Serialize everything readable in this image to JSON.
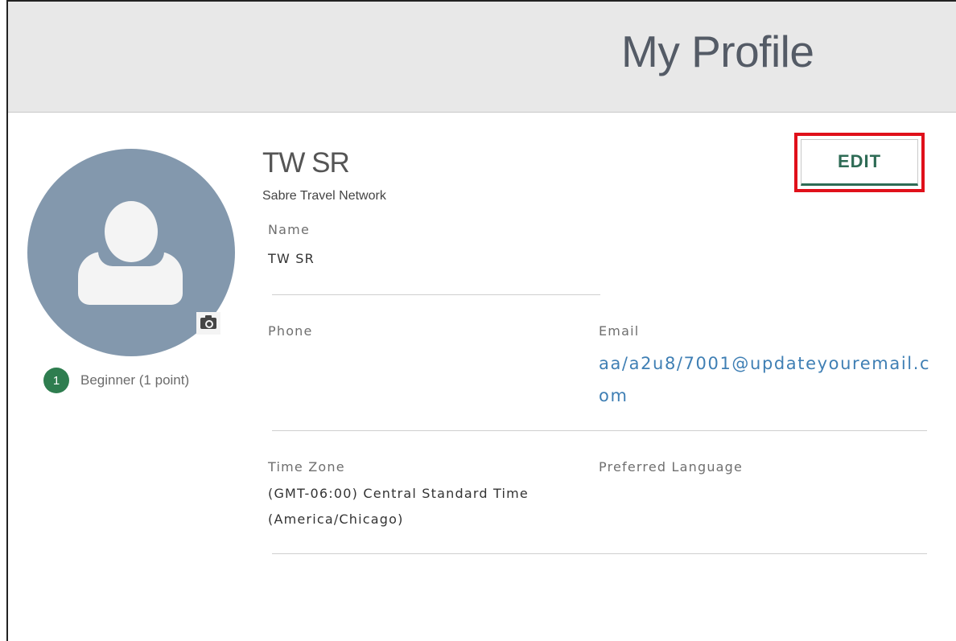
{
  "header": {
    "title": "My Profile"
  },
  "profile": {
    "display_name": "TW SR",
    "company": "Sabre Travel Network",
    "edit_label": "EDIT"
  },
  "rank": {
    "level": "1",
    "label": "Beginner (1 point)",
    "badge_color": "#2e7d4f"
  },
  "fields": {
    "name": {
      "label": "Name",
      "value": "TW SR"
    },
    "phone": {
      "label": "Phone",
      "value": ""
    },
    "email": {
      "label": "Email",
      "value": "aa/a2u8/7001@updateyouremail.com"
    },
    "time_zone": {
      "label": "Time Zone",
      "value": "(GMT-06:00) Central Standard Time (America/Chicago)"
    },
    "preferred_language": {
      "label": "Preferred Language",
      "value": ""
    }
  },
  "colors": {
    "accent": "#2e6b55",
    "link": "#3f7fb4",
    "highlight": "#e0101a",
    "avatar_bg": "#8398ad"
  },
  "icons": {
    "camera": "camera-icon",
    "avatar": "user-silhouette-icon"
  }
}
